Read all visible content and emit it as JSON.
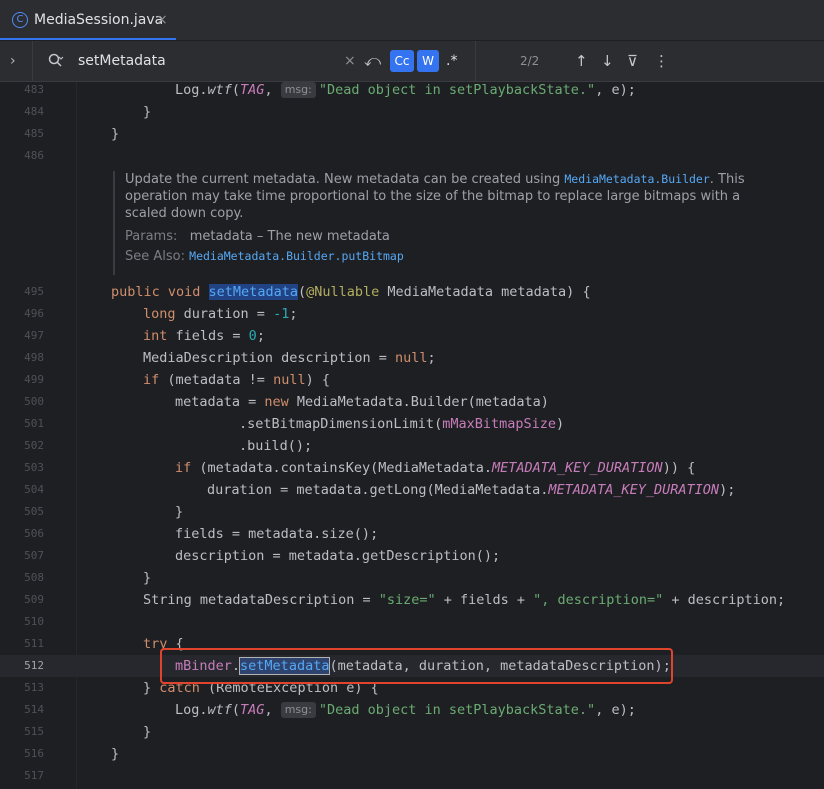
{
  "tab": {
    "icon": "class-icon",
    "icon_glyph": "C",
    "title": "MediaSession.java",
    "close": "×"
  },
  "search": {
    "expand": "›",
    "query": "setMetadata",
    "clear": "×",
    "history": "⤺",
    "match_case": "Cc",
    "words": "W",
    "regex": ".*",
    "count": "2/2",
    "prev": "↑",
    "next": "↓",
    "filter": "⊽",
    "more": "⋮"
  },
  "doc": {
    "text1": "Update the current metadata. New metadata can be created using ",
    "link1": "MediaMetadata.Builder",
    "text2": ". This operation may take time proportional to the size of the bitmap to replace large bitmaps with a scaled down copy.",
    "params_label": "Params:",
    "params_value": "metadata – The new metadata",
    "see_label": "See Also:",
    "see_link": "MediaMetadata.Builder.putBitmap"
  },
  "lines": [
    {
      "n": "483"
    },
    {
      "n": "484"
    },
    {
      "n": "485"
    },
    {
      "n": "486"
    },
    {
      "n": "495"
    },
    {
      "n": "496"
    },
    {
      "n": "497"
    },
    {
      "n": "498"
    },
    {
      "n": "499"
    },
    {
      "n": "500"
    },
    {
      "n": "501"
    },
    {
      "n": "502"
    },
    {
      "n": "503"
    },
    {
      "n": "504"
    },
    {
      "n": "505"
    },
    {
      "n": "506"
    },
    {
      "n": "507"
    },
    {
      "n": "508"
    },
    {
      "n": "509"
    },
    {
      "n": "510"
    },
    {
      "n": "511"
    },
    {
      "n": "512"
    },
    {
      "n": "513"
    },
    {
      "n": "514"
    },
    {
      "n": "515"
    },
    {
      "n": "516"
    },
    {
      "n": "517"
    }
  ],
  "code": {
    "l483_a": "Log.",
    "l483_b": "wtf",
    "l483_c": "(",
    "l483_d": "TAG",
    "l483_e": ", ",
    "l483_hint": "msg:",
    "l483_str": "\"Dead object in setPlaybackState.\"",
    "l483_f": ", e);",
    "l484": "}",
    "l485": "}",
    "l495_kw": "public void ",
    "l495_m": "setMetadata",
    "l495_p": "(",
    "l495_ann": "@Nullable",
    "l495_r": " MediaMetadata metadata) {",
    "l496_kw": "long",
    "l496_a": " duration = ",
    "l496_n": "-1",
    "l496_b": ";",
    "l497_kw": "int",
    "l497_a": " fields = ",
    "l497_n": "0",
    "l497_b": ";",
    "l498_a": "MediaDescription description = ",
    "l498_kw": "null",
    "l498_b": ";",
    "l499_kw": "if",
    "l499_a": " (metadata != ",
    "l499_kw2": "null",
    "l499_b": ") {",
    "l500_a": "metadata = ",
    "l500_kw": "new",
    "l500_b": " MediaMetadata.Builder(metadata)",
    "l501_a": ".setBitmapDimensionLimit(",
    "l501_f": "mMaxBitmapSize",
    "l501_b": ")",
    "l502": ".build();",
    "l503_kw": "if",
    "l503_a": " (metadata.containsKey(MediaMetadata.",
    "l503_f": "METADATA_KEY_DURATION",
    "l503_b": ")) {",
    "l504_a": "duration = metadata.getLong(MediaMetadata.",
    "l504_f": "METADATA_KEY_DURATION",
    "l504_b": ");",
    "l505": "}",
    "l506": "fields = metadata.size();",
    "l507": "description = metadata.getDescription();",
    "l508": "}",
    "l509_a": "String metadataDescription = ",
    "l509_s1": "\"size=\"",
    "l509_b": " + fields + ",
    "l509_s2": "\", description=\"",
    "l509_c": " + description;",
    "l511_kw": "try",
    "l511_b": " {",
    "l512_f": "mBinder",
    "l512_a": ".",
    "l512_m": "setMetadata",
    "l512_b": "(metadata, duration, metadataDescription);",
    "l513_a": "} ",
    "l513_kw": "catch",
    "l513_b": " (RemoteException e) {",
    "l514_a": "Log.",
    "l514_b": "wtf",
    "l514_c": "(",
    "l514_d": "TAG",
    "l514_e": ", ",
    "l514_hint": "msg:",
    "l514_str": "\"Dead object in setPlaybackState.\"",
    "l514_f": ", e);",
    "l515": "}",
    "l516": "}"
  },
  "colors": {
    "accent": "#3574f0",
    "keyword": "#cf8e6d",
    "string": "#6aab73",
    "number": "#2aacb8",
    "field": "#c77dbb",
    "method": "#56a8f5",
    "annotation": "#b3ae60",
    "highlight_box": "#e0442d"
  }
}
